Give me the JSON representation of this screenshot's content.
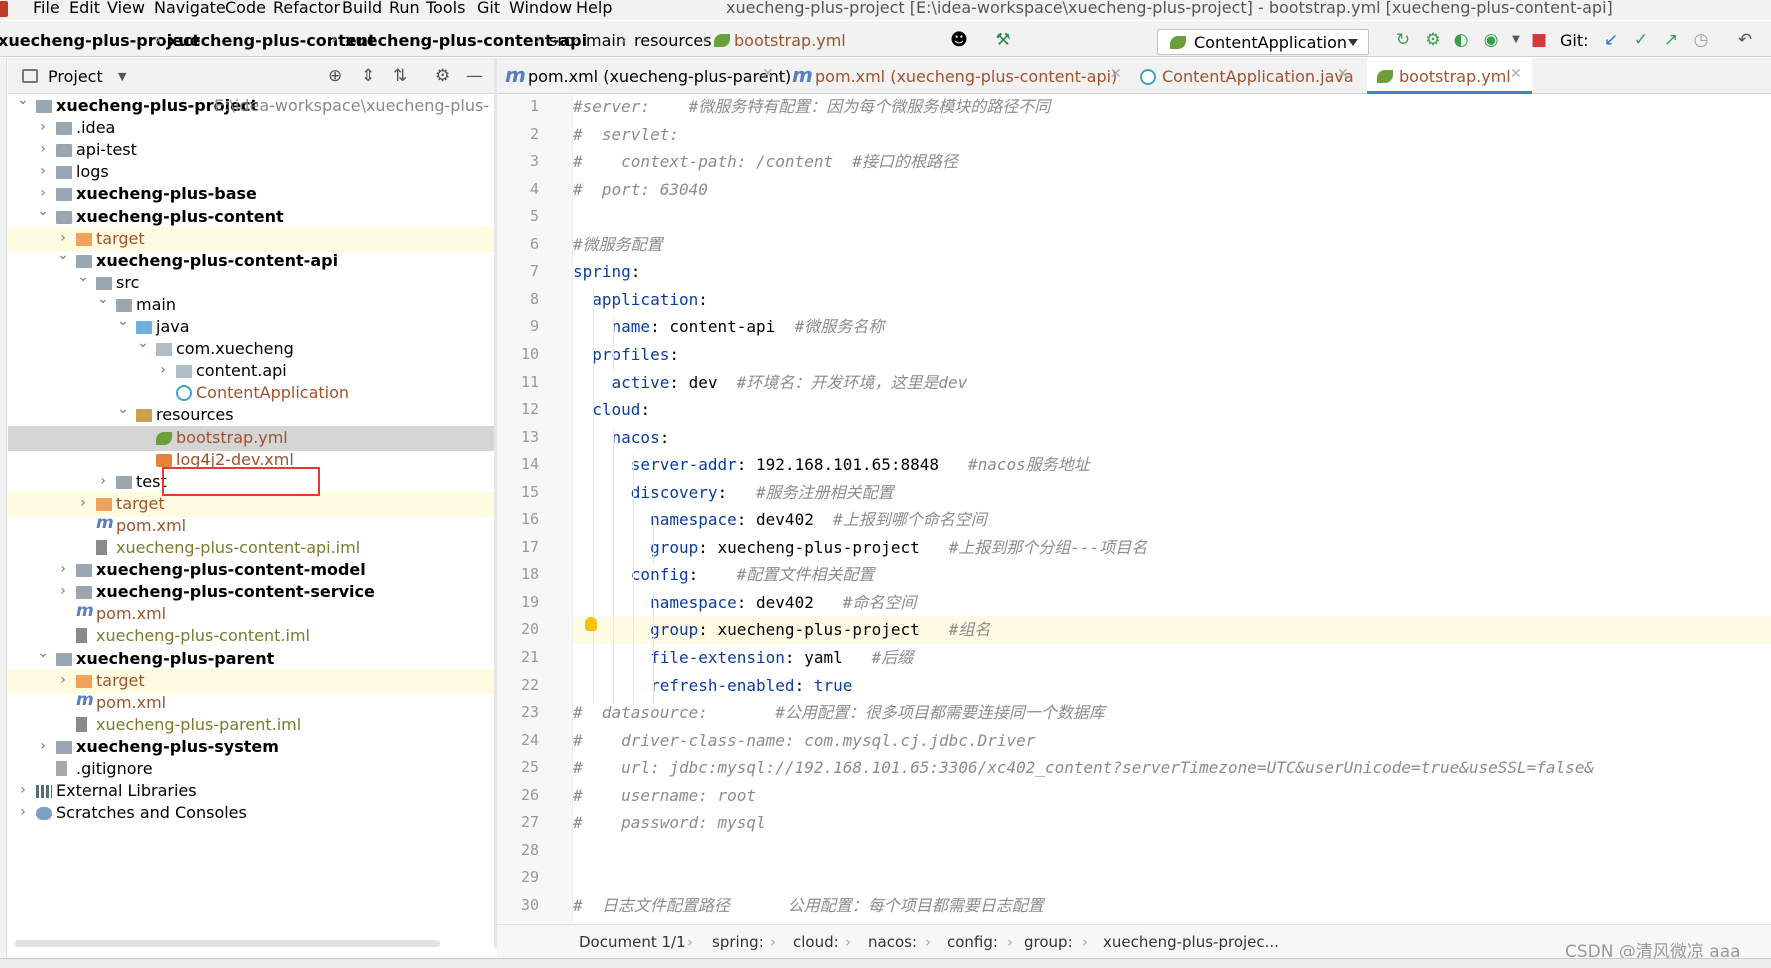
{
  "menu": {
    "items": [
      "File",
      "Edit",
      "View",
      "Navigate",
      "Code",
      "Refactor",
      "Build",
      "Run",
      "Tools",
      "Git",
      "Window",
      "Help"
    ],
    "window_title": "xuecheng-plus-project [E:\\idea-workspace\\xuecheng-plus-project] - bootstrap.yml [xuecheng-plus-content-api]"
  },
  "nav": {
    "crumbs": [
      "xuecheng-plus-project",
      "xuecheng-plus-content",
      "xuecheng-plus-content-api",
      "src",
      "main",
      "resources",
      "bootstrap.yml"
    ],
    "run_config": "ContentApplication",
    "git_label": "Git:"
  },
  "project_panel": {
    "title": "Project",
    "tree": [
      {
        "label": "xuecheng-plus-project",
        "path": "E:\\idea-workspace\\xuecheng-plus-",
        "bold": true,
        "chev": "v"
      },
      {
        "label": ".idea",
        "chev": ">"
      },
      {
        "label": "api-test",
        "chev": ">"
      },
      {
        "label": "logs",
        "chev": ">"
      },
      {
        "label": "xuecheng-plus-base",
        "bold": true,
        "chev": ">"
      },
      {
        "label": "xuecheng-plus-content",
        "bold": true,
        "chev": "v"
      },
      {
        "label": "target",
        "chev": ">"
      },
      {
        "label": "xuecheng-plus-content-api",
        "bold": true,
        "chev": "v"
      },
      {
        "label": "src",
        "chev": "v"
      },
      {
        "label": "main",
        "chev": "v"
      },
      {
        "label": "java",
        "chev": "v"
      },
      {
        "label": "com.xuecheng",
        "chev": "v"
      },
      {
        "label": "content.api",
        "chev": ">"
      },
      {
        "label": "ContentApplication",
        "chev": ""
      },
      {
        "label": "resources",
        "chev": "v"
      },
      {
        "label": "bootstrap.yml",
        "chev": ""
      },
      {
        "label": "log4j2-dev.xml",
        "chev": ""
      },
      {
        "label": "test",
        "chev": ">"
      },
      {
        "label": "target",
        "chev": ">"
      },
      {
        "label": "pom.xml",
        "chev": ""
      },
      {
        "label": "xuecheng-plus-content-api.iml",
        "chev": ""
      },
      {
        "label": "xuecheng-plus-content-model",
        "bold": true,
        "chev": ">"
      },
      {
        "label": "xuecheng-plus-content-service",
        "bold": true,
        "chev": ">"
      },
      {
        "label": "pom.xml",
        "chev": ""
      },
      {
        "label": "xuecheng-plus-content.iml",
        "chev": ""
      },
      {
        "label": "xuecheng-plus-parent",
        "bold": true,
        "chev": "v"
      },
      {
        "label": "target",
        "chev": ">"
      },
      {
        "label": "pom.xml",
        "chev": ""
      },
      {
        "label": "xuecheng-plus-parent.iml",
        "chev": ""
      },
      {
        "label": "xuecheng-plus-system",
        "bold": true,
        "chev": ">"
      },
      {
        "label": ".gitignore",
        "chev": ""
      },
      {
        "label": "External Libraries",
        "chev": ">"
      },
      {
        "label": "Scratches and Consoles",
        "chev": ">"
      }
    ]
  },
  "tabs": [
    {
      "label": "pom.xml (xuecheng-plus-parent)",
      "active": false
    },
    {
      "label": "pom.xml (xuecheng-plus-content-api)",
      "active": false
    },
    {
      "label": "ContentApplication.java",
      "active": false
    },
    {
      "label": "bootstrap.yml",
      "active": true
    }
  ],
  "editor": {
    "line_numbers": [
      "1",
      "2",
      "3",
      "4",
      "5",
      "6",
      "7",
      "8",
      "9",
      "10",
      "11",
      "12",
      "13",
      "14",
      "15",
      "16",
      "17",
      "18",
      "19",
      "20",
      "21",
      "22",
      "23",
      "24",
      "25",
      "26",
      "27",
      "28",
      "29",
      "30"
    ],
    "lines": [
      [
        {
          "t": "c",
          "s": "#server:    #微服务特有配置：因为每个微服务模块的路径不同"
        }
      ],
      [
        {
          "t": "c",
          "s": "#  servlet:"
        }
      ],
      [
        {
          "t": "c",
          "s": "#    context-path: /content  #接口的根路径"
        }
      ],
      [
        {
          "t": "c",
          "s": "#  port: 63040"
        }
      ],
      [],
      [
        {
          "t": "c",
          "s": "#微服务配置"
        }
      ],
      [
        {
          "t": "k",
          "s": "spring"
        },
        {
          "t": "v",
          "s": ":"
        }
      ],
      [
        {
          "t": "v",
          "s": "  "
        },
        {
          "t": "k",
          "s": "application"
        },
        {
          "t": "v",
          "s": ":"
        }
      ],
      [
        {
          "t": "v",
          "s": "    "
        },
        {
          "t": "k",
          "s": "name"
        },
        {
          "t": "v",
          "s": ": content-api  "
        },
        {
          "t": "c",
          "s": "#微服务名称"
        }
      ],
      [
        {
          "t": "v",
          "s": "  "
        },
        {
          "t": "k",
          "s": "profiles"
        },
        {
          "t": "v",
          "s": ":"
        }
      ],
      [
        {
          "t": "v",
          "s": "    "
        },
        {
          "t": "k",
          "s": "active"
        },
        {
          "t": "v",
          "s": ": dev  "
        },
        {
          "t": "c",
          "s": "#环境名：开发环境，这里是dev"
        }
      ],
      [
        {
          "t": "v",
          "s": "  "
        },
        {
          "t": "k",
          "s": "cloud"
        },
        {
          "t": "v",
          "s": ":"
        }
      ],
      [
        {
          "t": "v",
          "s": "    "
        },
        {
          "t": "k",
          "s": "nacos"
        },
        {
          "t": "v",
          "s": ":"
        }
      ],
      [
        {
          "t": "v",
          "s": "      "
        },
        {
          "t": "k",
          "s": "server-addr"
        },
        {
          "t": "v",
          "s": ": 192.168.101.65:8848   "
        },
        {
          "t": "c",
          "s": "#nacos服务地址"
        }
      ],
      [
        {
          "t": "v",
          "s": "      "
        },
        {
          "t": "k",
          "s": "discovery"
        },
        {
          "t": "v",
          "s": ":   "
        },
        {
          "t": "c",
          "s": "#服务注册相关配置"
        }
      ],
      [
        {
          "t": "v",
          "s": "        "
        },
        {
          "t": "k",
          "s": "namespace"
        },
        {
          "t": "v",
          "s": ": dev402  "
        },
        {
          "t": "c",
          "s": "#上报到哪个命名空间"
        }
      ],
      [
        {
          "t": "v",
          "s": "        "
        },
        {
          "t": "k",
          "s": "group"
        },
        {
          "t": "v",
          "s": ": xuecheng-plus-project   "
        },
        {
          "t": "c",
          "s": "#上报到那个分组---项目名"
        }
      ],
      [
        {
          "t": "v",
          "s": "      "
        },
        {
          "t": "k",
          "s": "config"
        },
        {
          "t": "v",
          "s": ":    "
        },
        {
          "t": "c",
          "s": "#配置文件相关配置"
        }
      ],
      [
        {
          "t": "v",
          "s": "        "
        },
        {
          "t": "k",
          "s": "namespace"
        },
        {
          "t": "v",
          "s": ": dev402   "
        },
        {
          "t": "c",
          "s": "#命名空间"
        }
      ],
      [
        {
          "t": "v",
          "s": "        "
        },
        {
          "t": "k",
          "s": "group"
        },
        {
          "t": "v",
          "s": ": xuecheng-plus-project   "
        },
        {
          "t": "c",
          "s": "#组名"
        }
      ],
      [
        {
          "t": "v",
          "s": "        "
        },
        {
          "t": "k",
          "s": "file-extension"
        },
        {
          "t": "v",
          "s": ": yaml   "
        },
        {
          "t": "c",
          "s": "#后缀"
        }
      ],
      [
        {
          "t": "v",
          "s": "        "
        },
        {
          "t": "k",
          "s": "refresh-enabled"
        },
        {
          "t": "v",
          "s": ": "
        },
        {
          "t": "k",
          "s": "true"
        }
      ],
      [
        {
          "t": "c",
          "s": "#  datasource:       #公用配置：很多项目都需要连接同一个数据库"
        }
      ],
      [
        {
          "t": "c",
          "s": "#    driver-class-name: com.mysql.cj.jdbc.Driver"
        }
      ],
      [
        {
          "t": "c",
          "s": "#    url: jdbc:mysql://192.168.101.65:3306/xc402_content?serverTimezone=UTC&userUnicode=true&useSSL=false&"
        }
      ],
      [
        {
          "t": "c",
          "s": "#    username: root"
        }
      ],
      [
        {
          "t": "c",
          "s": "#    password: mysql"
        }
      ],
      [],
      [],
      [
        {
          "t": "c",
          "s": "#  日志文件配置路径      公用配置：每个项目都需要日志配置"
        }
      ]
    ]
  },
  "breadcrumb": [
    "Document 1/1",
    "spring:",
    "cloud:",
    "nacos:",
    "config:",
    "group:",
    "xuecheng-plus-projec..."
  ],
  "watermark": "CSDN @清风微凉 aaa",
  "colors": {
    "accent": "#4083c9",
    "keyword": "#0a3d9e",
    "comment": "#8c8c8c",
    "highlight_box": "#e53935"
  }
}
